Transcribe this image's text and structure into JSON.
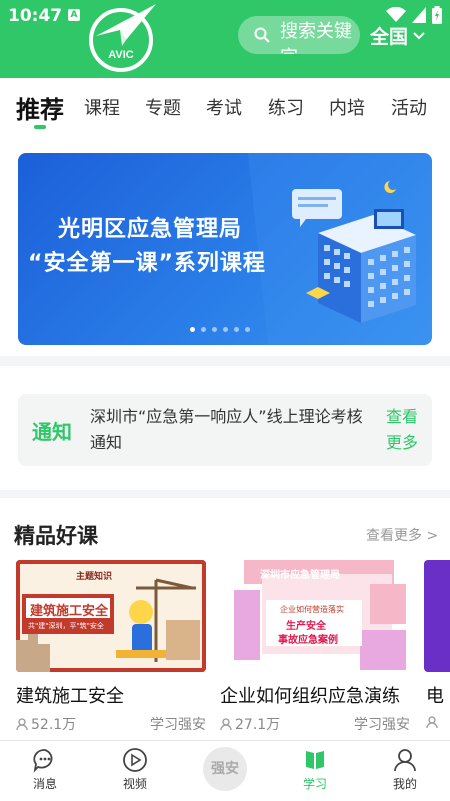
{
  "status_bar": {
    "time": "10:47",
    "badge": "A"
  },
  "header": {
    "logo_text": "AVIC",
    "search_placeholder": "搜索关键字",
    "region": "全国"
  },
  "tabs": [
    "推荐",
    "课程",
    "专题",
    "考试",
    "练习",
    "内培",
    "活动"
  ],
  "banner": {
    "title_line1": "光明区应急管理局",
    "title_line2": "“安全第一课”系列课程",
    "page_count": 6,
    "active_page": 1
  },
  "notice": {
    "label": "通知",
    "text": "深圳市“应急第一响应人”线上理论考核通知",
    "more": "查看更多"
  },
  "featured": {
    "title": "精品好课",
    "more": "查看更多 >",
    "courses": [
      {
        "title": "建筑施工安全",
        "views": "52.1万",
        "source": "学习强安",
        "thumb_tag": "主题知识",
        "thumb_heading": "建筑施工安全",
        "thumb_sub": "共\"建\"深圳，平\"筑\"安全"
      },
      {
        "title": "企业如何组织应急演练",
        "views": "27.1万",
        "source": "学习强安",
        "thumb_heading": "深圳市应急管理局",
        "thumb_sub1": "企业如何营造落实",
        "thumb_sub2": "生产安全",
        "thumb_sub3": "事故应急案例"
      },
      {
        "title": "电"
      }
    ]
  },
  "bottom_nav": {
    "items": [
      {
        "label": "消息",
        "icon": "chat-icon"
      },
      {
        "label": "视频",
        "icon": "play-icon"
      },
      {
        "label": "学习",
        "icon": "book-icon"
      },
      {
        "label": "我的",
        "icon": "user-icon"
      }
    ],
    "center_label": "强安"
  },
  "colors": {
    "brand": "#2fc768",
    "banner": "#2a7de8"
  }
}
